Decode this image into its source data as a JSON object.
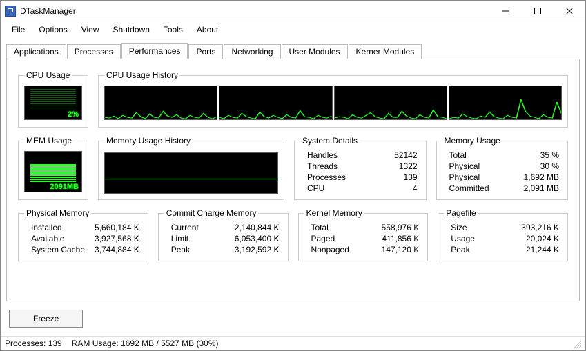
{
  "window": {
    "title": "DTaskManager"
  },
  "menu": [
    "File",
    "Options",
    "View",
    "Shutdown",
    "Tools",
    "About"
  ],
  "tabs": [
    "Applications",
    "Processes",
    "Performances",
    "Ports",
    "Networking",
    "User Modules",
    "Kerner Modules"
  ],
  "active_tab": "Performances",
  "cpu_usage": {
    "label": "CPU Usage",
    "value": "2%"
  },
  "cpu_history": {
    "label": "CPU Usage History"
  },
  "mem_usage": {
    "label": "MEM Usage",
    "value": "2091MB"
  },
  "mem_history": {
    "label": "Memory Usage History"
  },
  "system_details": {
    "label": "System Details",
    "Handles": "52142",
    "Threads": "1322",
    "Processes": "139",
    "CPU": "4"
  },
  "memory_usage": {
    "label": "Memory Usage",
    "Total": "35 %",
    "Physical_pct": "30 %",
    "Physical": "1,692 MB",
    "Committed": "2,091 MB"
  },
  "physical_memory": {
    "label": "Physical Memory",
    "Installed": "5,660,184 K",
    "Available": "3,927,568 K",
    "System_Cache": "3,744,884 K"
  },
  "commit_charge": {
    "label": "Commit Charge Memory",
    "Current": "2,140,844 K",
    "Limit": "6,053,400 K",
    "Peak": "3,192,592 K"
  },
  "kernel_memory": {
    "label": "Kernel Memory",
    "Total": "558,976 K",
    "Paged": "411,856 K",
    "Nonpaged": "147,120 K"
  },
  "pagefile": {
    "label": "Pagefile",
    "Size": "393,216 K",
    "Usage": "20,024 K",
    "Peak": "21,244 K"
  },
  "freeze": "Freeze",
  "status": {
    "processes": "Processes: 139",
    "ram": "RAM Usage:  1692 MB / 5527 MB (30%)"
  },
  "labels": {
    "Handles": "Handles",
    "Threads": "Threads",
    "Processes": "Processes",
    "CPU": "CPU",
    "Total": "Total",
    "Physical_pct": "Physical",
    "Physical": "Physical",
    "Committed": "Committed",
    "Installed": "Installed",
    "Available": "Available",
    "System_Cache": "System Cache",
    "Current": "Current",
    "Limit": "Limit",
    "Peak": "Peak",
    "Paged": "Paged",
    "Nonpaged": "Nonpaged",
    "Size": "Size",
    "Usage": "Usage"
  },
  "chart_data": [
    {
      "type": "line",
      "title": "CPU Usage History Core 1",
      "ylim": [
        0,
        100
      ],
      "values": [
        5,
        3,
        8,
        2,
        10,
        4,
        3,
        18,
        6,
        2,
        14,
        5,
        3,
        22,
        8,
        4,
        12,
        3,
        2,
        9,
        5,
        3,
        15,
        4,
        2,
        7,
        3,
        10,
        4,
        2
      ]
    },
    {
      "type": "line",
      "title": "CPU Usage History Core 2",
      "ylim": [
        0,
        100
      ],
      "values": [
        4,
        2,
        11,
        5,
        3,
        16,
        7,
        3,
        2,
        20,
        6,
        3,
        9,
        4,
        2,
        13,
        5,
        3,
        24,
        7,
        4,
        2,
        10,
        5,
        3,
        8,
        4,
        2,
        6,
        3
      ]
    },
    {
      "type": "line",
      "title": "CPU Usage History Core 3",
      "ylim": [
        0,
        100
      ],
      "values": [
        3,
        7,
        4,
        2,
        12,
        5,
        3,
        9,
        18,
        6,
        3,
        2,
        15,
        5,
        4,
        22,
        8,
        3,
        2,
        11,
        5,
        3,
        25,
        7,
        4,
        2,
        9,
        5,
        3,
        6
      ]
    },
    {
      "type": "line",
      "title": "CPU Usage History Core 4",
      "ylim": [
        0,
        100
      ],
      "values": [
        2,
        5,
        3,
        14,
        6,
        3,
        2,
        8,
        4,
        20,
        7,
        3,
        2,
        10,
        5,
        3,
        55,
        22,
        8,
        4,
        2,
        12,
        5,
        3,
        9,
        4,
        2,
        48,
        15,
        5
      ]
    },
    {
      "type": "line",
      "title": "Memory Usage History",
      "ylim": [
        0,
        100
      ],
      "values": [
        35,
        35,
        35,
        35,
        35,
        35,
        35,
        35,
        35,
        35,
        35,
        35,
        35,
        35,
        35,
        35,
        35,
        35,
        35,
        35,
        35,
        35,
        35,
        35,
        35,
        35,
        35,
        35,
        35,
        35
      ]
    }
  ]
}
